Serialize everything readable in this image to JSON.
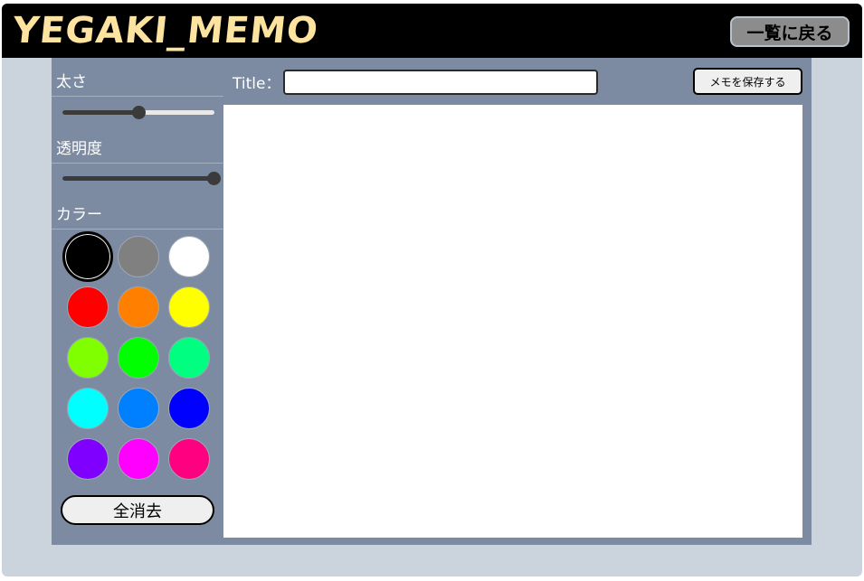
{
  "header": {
    "logo_text": "YEGAKI_MEMO",
    "back_label": "一覧に戻る"
  },
  "sidebar": {
    "thickness_label": "太さ",
    "thickness_value": 0.5,
    "opacity_label": "透明度",
    "opacity_value": 1.0,
    "color_label": "カラー",
    "colors": [
      "#000000",
      "#808080",
      "#ffffff",
      "#ff0000",
      "#ff8000",
      "#ffff00",
      "#80ff00",
      "#00ff00",
      "#00ff80",
      "#00ffff",
      "#0080ff",
      "#0000ff",
      "#8000ff",
      "#ff00ff",
      "#ff0080"
    ],
    "selected_color": "#000000",
    "clear_label": "全消去"
  },
  "editor": {
    "title_label": "Title：",
    "title_value": "",
    "title_placeholder": "",
    "save_label": "メモを保存する"
  }
}
